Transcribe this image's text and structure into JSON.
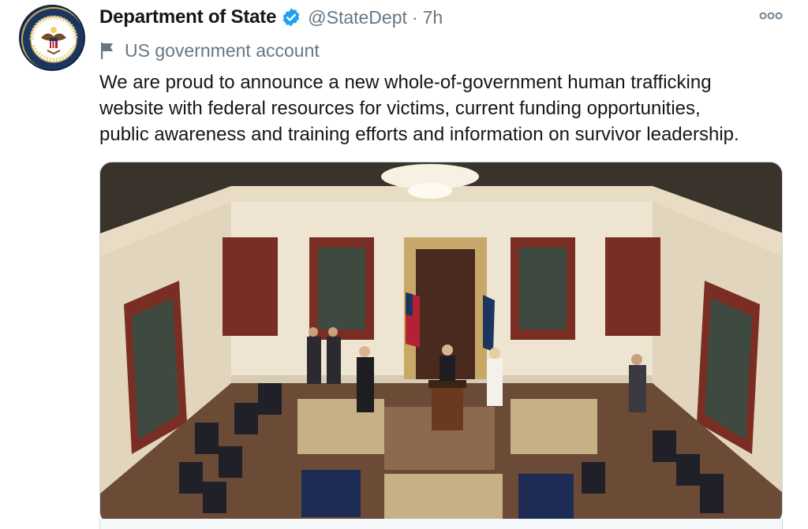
{
  "tweet": {
    "author_name": "Department of State",
    "handle": "@StateDept",
    "separator": "·",
    "time": "7h",
    "account_label": "US government account",
    "text": "We are proud to announce a new whole-of-government human trafficking\nwebsite with federal resources for victims, current funding opportunities,\npublic awareness and training efforts and information on survivor leadership.",
    "icons": {
      "verified": "verified-badge-icon",
      "label": "flag-icon",
      "more": "more-options-icon",
      "avatar": "department-of-state-seal"
    },
    "colors": {
      "verified": "#1da1f2",
      "secondary_text": "#657786",
      "primary_text": "#14171a"
    }
  }
}
